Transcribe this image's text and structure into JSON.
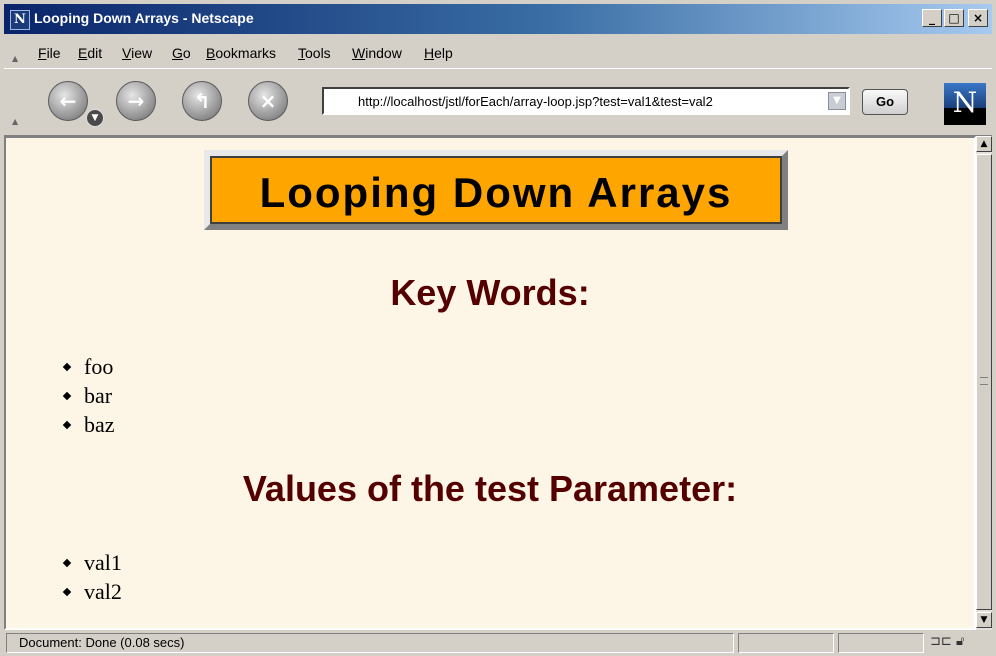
{
  "window": {
    "title": "Looping Down Arrays - Netscape",
    "minimize_label": "_",
    "maximize_label": "□",
    "close_label": "×"
  },
  "menu": {
    "items": [
      {
        "first": "F",
        "rest": "ile"
      },
      {
        "first": "E",
        "rest": "dit"
      },
      {
        "first": "V",
        "rest": "iew"
      },
      {
        "first": "G",
        "rest": "o"
      },
      {
        "first": "B",
        "rest": "ookmarks"
      },
      {
        "first": "T",
        "rest": "ools"
      },
      {
        "first": "W",
        "rest": "indow"
      },
      {
        "first": "H",
        "rest": "elp"
      }
    ]
  },
  "toolbar": {
    "back_icon": "back-arrow-icon",
    "forward_icon": "forward-arrow-icon",
    "reload_icon": "reload-icon",
    "stop_icon": "stop-icon",
    "url": "http://localhost/jstl/forEach/array-loop.jsp?test=val1&test=val2",
    "go_label": "Go",
    "logo_letter": "N"
  },
  "page": {
    "banner_title": "Looping Down Arrays",
    "banner_color": "#ffa500",
    "heading_color": "#550000",
    "background": "#fdf5e6",
    "keywords_heading": "Key Words:",
    "keywords": [
      "foo",
      "bar",
      "baz"
    ],
    "values_heading": "Values of the test Parameter:",
    "values": [
      "val1",
      "val2"
    ]
  },
  "status": {
    "text": "Document: Done (0.08 secs)"
  }
}
